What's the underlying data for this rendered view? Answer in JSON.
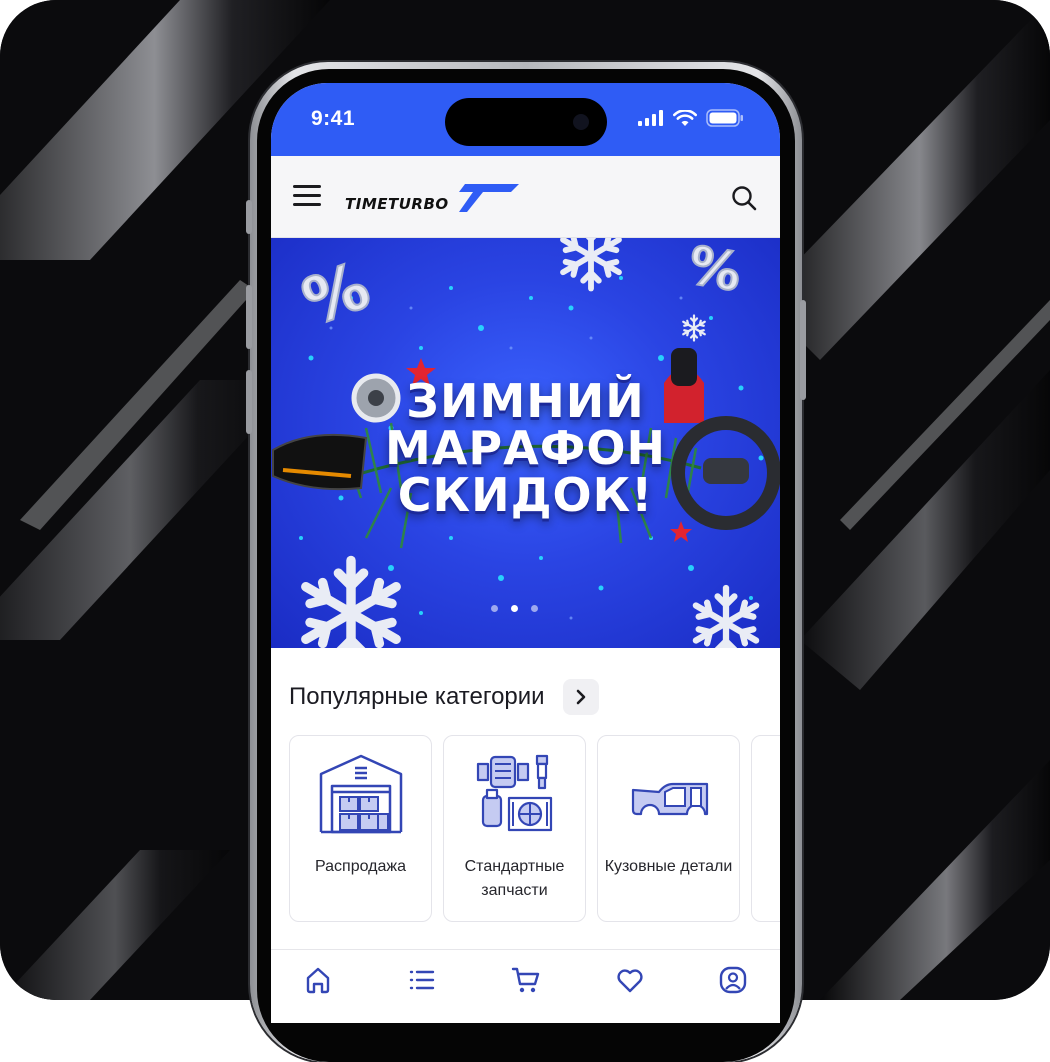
{
  "status_bar": {
    "time": "9:41"
  },
  "header": {
    "logo_text": "TIMETURBO"
  },
  "banner": {
    "title_lines": [
      "ЗИМНИЙ",
      "МАРАФОН",
      "СКИДОК!"
    ],
    "slide_count": 3,
    "active_slide": 1
  },
  "categories": {
    "title": "Популярные категории",
    "items": [
      {
        "label": "Распродажа",
        "icon": "warehouse-icon"
      },
      {
        "label": "Стандартные запчасти",
        "icon": "engine-parts-icon"
      },
      {
        "label": "Кузовные детали",
        "icon": "car-body-icon"
      }
    ]
  },
  "tabbar": {
    "items": [
      {
        "icon": "home-icon",
        "active": true
      },
      {
        "icon": "catalog-list-icon",
        "active": false
      },
      {
        "icon": "cart-icon",
        "active": false
      },
      {
        "icon": "heart-icon",
        "active": false
      },
      {
        "icon": "profile-icon",
        "active": false
      }
    ]
  },
  "colors": {
    "brand_blue": "#2f5cf5",
    "icon_blue": "#3346b5",
    "tab_icon": "#3346b5"
  }
}
